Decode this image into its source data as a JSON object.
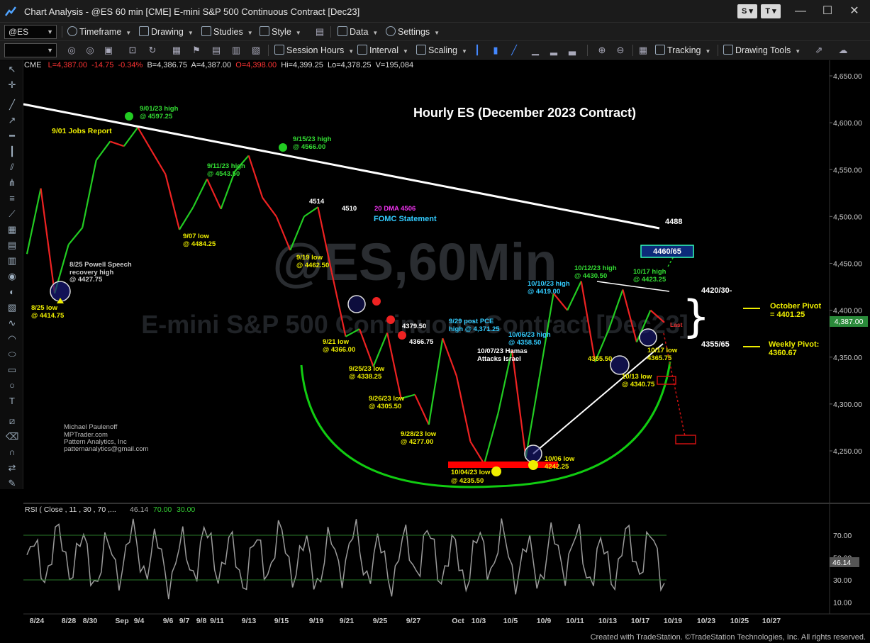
{
  "window": {
    "title": "Chart Analysis - @ES 60 min [CME] E-mini S&P 500 Continuous Contract [Dec23]",
    "buttons": [
      "S",
      "T"
    ],
    "controls": [
      "—",
      "☐",
      "✕"
    ]
  },
  "toolbar1": {
    "symbol": "@ES",
    "items": [
      "Timeframe",
      "Drawing",
      "Studies",
      "Style",
      "Data",
      "Settings"
    ]
  },
  "toolbar2": {
    "items": [
      "Session Hours",
      "Interval",
      "Scaling",
      "Tracking",
      "Drawing Tools"
    ]
  },
  "header": {
    "exchange": "CME",
    "last": "L=4,387.00",
    "change": "-14.75",
    "change_pct": "-0.34%",
    "bid": "B=4,386.75",
    "ask": "A=4,387.00",
    "open": "O=4,398.00",
    "high": "Hi=4,399.25",
    "low": "Lo=4,378.25",
    "volume": "V=195,084"
  },
  "chart_data": {
    "type": "candlestick",
    "title": "Hourly ES (December 2023 Contract)",
    "watermark": [
      "@ES,60Min",
      "E-mini S&P 500 Continuous Contract [Dec23]"
    ],
    "price_ticks": [
      "4,650.00",
      "4,600.00",
      "4,550.00",
      "4,500.00",
      "4,450.00",
      "4,400.00",
      "4,350.00",
      "4,300.00",
      "4,250.00"
    ],
    "last_price_label": "4,387.00",
    "date_ticks": [
      "8/24",
      "8/28",
      "8/30",
      "Sep",
      "9/4",
      "9/6",
      "9/7",
      "9/8",
      "9/11",
      "9/13",
      "9/15",
      "9/19",
      "9/21",
      "9/25",
      "9/27",
      "Oct",
      "10/3",
      "10/5",
      "10/9",
      "10/11",
      "10/13",
      "10/17",
      "10/19",
      "10/23",
      "10/25",
      "10/27"
    ],
    "path_points": [
      [
        "8/24",
        4460
      ],
      [
        "8/24",
        4530
      ],
      [
        "8/25",
        4418
      ],
      [
        "8/25",
        4470
      ],
      [
        "8/28",
        4488
      ],
      [
        "8/28",
        4560
      ],
      [
        "8/30",
        4580
      ],
      [
        "Sep",
        4575
      ],
      [
        "9/1",
        4595
      ],
      [
        "9/4",
        4570
      ],
      [
        "9/6",
        4545
      ],
      [
        "9/7",
        4486
      ],
      [
        "9/8",
        4510
      ],
      [
        "9/11",
        4540
      ],
      [
        "9/13",
        4508
      ],
      [
        "9/14",
        4548
      ],
      [
        "9/15",
        4565
      ],
      [
        "9/15",
        4520
      ],
      [
        "9/18",
        4500
      ],
      [
        "9/19",
        4464
      ],
      [
        "9/19",
        4500
      ],
      [
        "9/20",
        4510
      ],
      [
        "9/20",
        4440
      ],
      [
        "9/21",
        4372
      ],
      [
        "9/22",
        4380
      ],
      [
        "9/25",
        4340
      ],
      [
        "9/25",
        4376
      ],
      [
        "9/26",
        4306
      ],
      [
        "9/27",
        4310
      ],
      [
        "9/28",
        4278
      ],
      [
        "9/29",
        4370
      ],
      [
        "Oct",
        4330
      ],
      [
        "10/3",
        4260
      ],
      [
        "10/4",
        4236
      ],
      [
        "10/5",
        4290
      ],
      [
        "10/6",
        4358
      ],
      [
        "10/6",
        4243
      ],
      [
        "10/9",
        4330
      ],
      [
        "10/10",
        4418
      ],
      [
        "10/11",
        4400
      ],
      [
        "10/12",
        4431
      ],
      [
        "10/13",
        4345
      ],
      [
        "10/16",
        4380
      ],
      [
        "10/17",
        4422
      ],
      [
        "10/17",
        4366
      ],
      [
        "10/18",
        4400
      ],
      [
        "10/18",
        4387
      ]
    ],
    "rsi": {
      "label": "RSI ( Close , 11 , 30 , 70 ,...",
      "values": [
        "46.14",
        "70.00",
        "30.00"
      ],
      "ticks": [
        "70.00",
        "50.00",
        "30.00",
        "10.00"
      ],
      "last": "46.14"
    },
    "annotations": {
      "a901high": [
        "9/01/23 high",
        "@ 4597.25"
      ],
      "jobs": "9/01 Jobs Report",
      "a915high": [
        "9/15/23 high",
        "@ 4566.00"
      ],
      "a911high": [
        "9/11/23 high",
        "@ 4543.50"
      ],
      "a907low": [
        "9/07 low",
        "@ 4484.25"
      ],
      "n4514": "4514",
      "n4510": "4510",
      "dma": "20 DMA 4506",
      "fomc": "FOMC Statement",
      "a919low": [
        "9/19 low",
        "@ 4462.50"
      ],
      "powell": [
        "8/25 Powell Speech",
        "recovery high",
        "@ 4427.75"
      ],
      "a825low": [
        "8/25 low",
        "@ 4414.75"
      ],
      "a921low": [
        "9/21 low",
        "@ 4366.00"
      ],
      "n437950": "4379.50",
      "n436675": "4366.75",
      "a925low": [
        "9/25/23 low",
        "@ 4338.25"
      ],
      "a926low": [
        "9/26/23 low",
        "@ 4305.50"
      ],
      "a928low": [
        "9/28/23 low",
        "@ 4277.00"
      ],
      "pce": [
        "9/29 post PCE",
        "high @ 4,371.25"
      ],
      "a1006high": [
        "10/06/23 high",
        "@ 4358.50"
      ],
      "hamas": [
        "10/07/23 Hamas",
        "Attacks Israel"
      ],
      "a1010high": [
        "10/10/23 high",
        "@ 4419.00"
      ],
      "a1012high": [
        "10/12/23 high",
        "@ 4430.50"
      ],
      "a1017high": [
        "10/17 high",
        "@ 4423.25"
      ],
      "n4488": "4488",
      "target": "4460/65",
      "r4420": "4420/30-",
      "octpivot": [
        "October Pivot",
        "= 4401.25"
      ],
      "wkpivot": [
        "Weekly Pivot:",
        "4360.67"
      ],
      "s4355": "4355/65",
      "a1017low": [
        "10/17 low",
        "4365.75"
      ],
      "n435550": "4355.50",
      "a1013low": [
        "10/13 low",
        "@ 4340.75"
      ],
      "a1004low": [
        "10/04/23 low",
        "@ 4235.50"
      ],
      "a1006low": [
        "10/06 low",
        "4242.25"
      ],
      "last": "Last",
      "author": [
        "Michael Paulenoff",
        "MPTrader.com",
        "Pattern Analytics, Inc",
        "patternanalytics@gmail.com"
      ]
    }
  },
  "footer": "Created with TradeStation. ©TradeStation Technologies, Inc. All rights reserved."
}
